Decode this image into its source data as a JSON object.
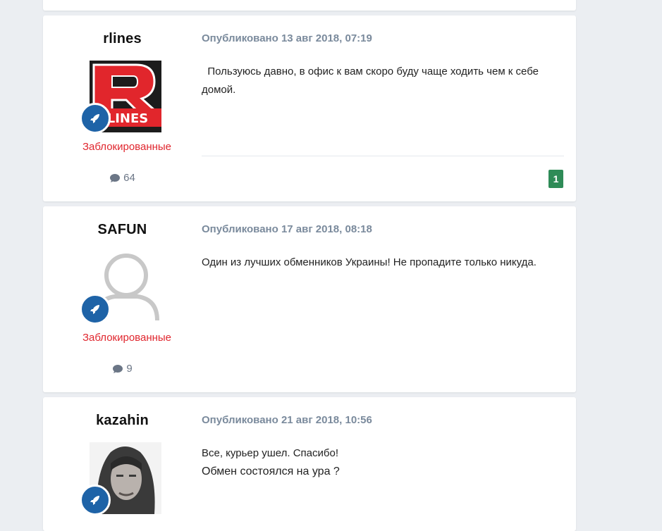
{
  "posts": [
    {
      "username": "rlines",
      "avatar_text": "LINES",
      "group": "Заблокированные",
      "post_count": "64",
      "published": "Опубликовано 13 авг 2018, 07:19",
      "lines": [
        "  Пользуюсь давно, в офис к вам скоро буду чаще ходить чем к себе домой."
      ],
      "reaction": "1"
    },
    {
      "username": "SAFUN",
      "group": "Заблокированные",
      "post_count": "9",
      "published": "Опубликовано 17 авг 2018, 08:18",
      "lines": [
        "Один из лучших обменников Украины! Не пропадите только никуда."
      ]
    },
    {
      "username": "kazahin",
      "published": "Опубликовано 21 авг 2018, 10:56",
      "lines": [
        "Все, курьер ушел. Спасибо!",
        "Обмен состоялся на ура ?"
      ]
    }
  ],
  "icons": {
    "badge": "rocket-icon",
    "comments": "comment-icon"
  },
  "colors": {
    "blocked_group": "#e0262e",
    "badge": "#1e63a7",
    "reaction": "#2e8b57",
    "meta": "#7a8a9c"
  }
}
